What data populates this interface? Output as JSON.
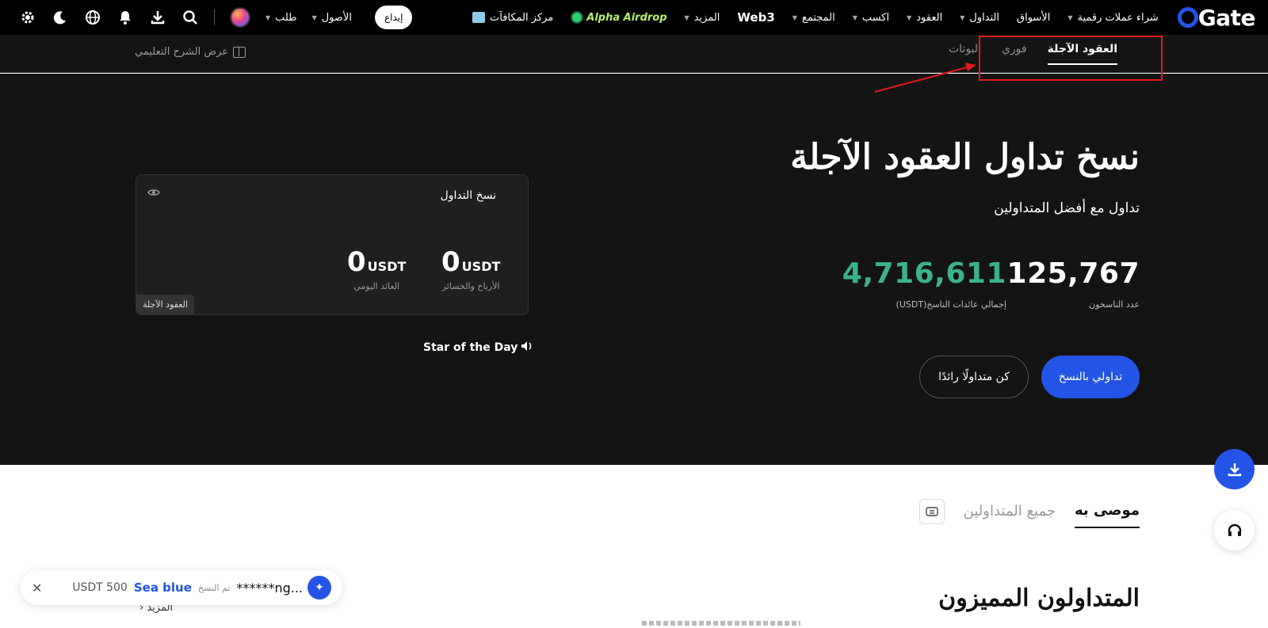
{
  "topbar": {
    "logo": "Gate",
    "nav": [
      {
        "label": "شراء عملات رقمية",
        "dropdown": true
      },
      {
        "label": "الأسواق",
        "dropdown": false
      },
      {
        "label": "التداول",
        "dropdown": true
      },
      {
        "label": "العقود",
        "dropdown": true
      },
      {
        "label": "اكسب",
        "dropdown": true
      },
      {
        "label": "المجتمع",
        "dropdown": true
      },
      {
        "label": "Web3",
        "dropdown": false
      },
      {
        "label": "المزيد",
        "dropdown": true
      }
    ],
    "airdrop": "Alpha Airdrop",
    "reward_center": "مركز المكافآت",
    "deposit": "إيداع",
    "assets": "الأصول",
    "order": "طلب",
    "icons": [
      "settings-icon",
      "moon-icon",
      "globe-icon",
      "bell-icon",
      "download-icon",
      "search-icon"
    ]
  },
  "subnav": {
    "tabs": [
      "العقود الآجلة",
      "فوري",
      "البوتات"
    ],
    "active_tab": 0,
    "tutorial": "عرض الشرح التعليمي"
  },
  "hero": {
    "title": "نسخ تداول العقود الآجلة",
    "subtitle": "تداول مع أفضل المتداولين",
    "copiers_value": "125,767",
    "copiers_label": "عدد الناسخون",
    "pnl_value": "4,716,611",
    "pnl_label": "إجمالي عائدات الناسخ(USDT)",
    "btn_copy": "تداولي بالنسخ",
    "btn_lead": "كن متداولًا رائدًا",
    "accent_green": "#3bb389",
    "accent_blue": "#2354e6"
  },
  "card": {
    "title": "نسخ التداول",
    "pnl_value": "0",
    "pnl_unit": "USDT",
    "pnl_label": "الأرباح والخسائر",
    "daily_value": "0",
    "daily_unit": "USDT",
    "daily_label": "العائد اليومي",
    "tag": "العقود الآجلة"
  },
  "star_of_day": "Star of the Day",
  "lower": {
    "tabs": [
      "موصى به",
      "جميع المتداولين"
    ],
    "active_tab": 0,
    "section_title": "المتداولون المميزون",
    "more": "المزيد"
  },
  "toast": {
    "amount": "USDT 500",
    "trader": "Sea blue",
    "action": "تم النسخ",
    "user": "******ng..."
  }
}
